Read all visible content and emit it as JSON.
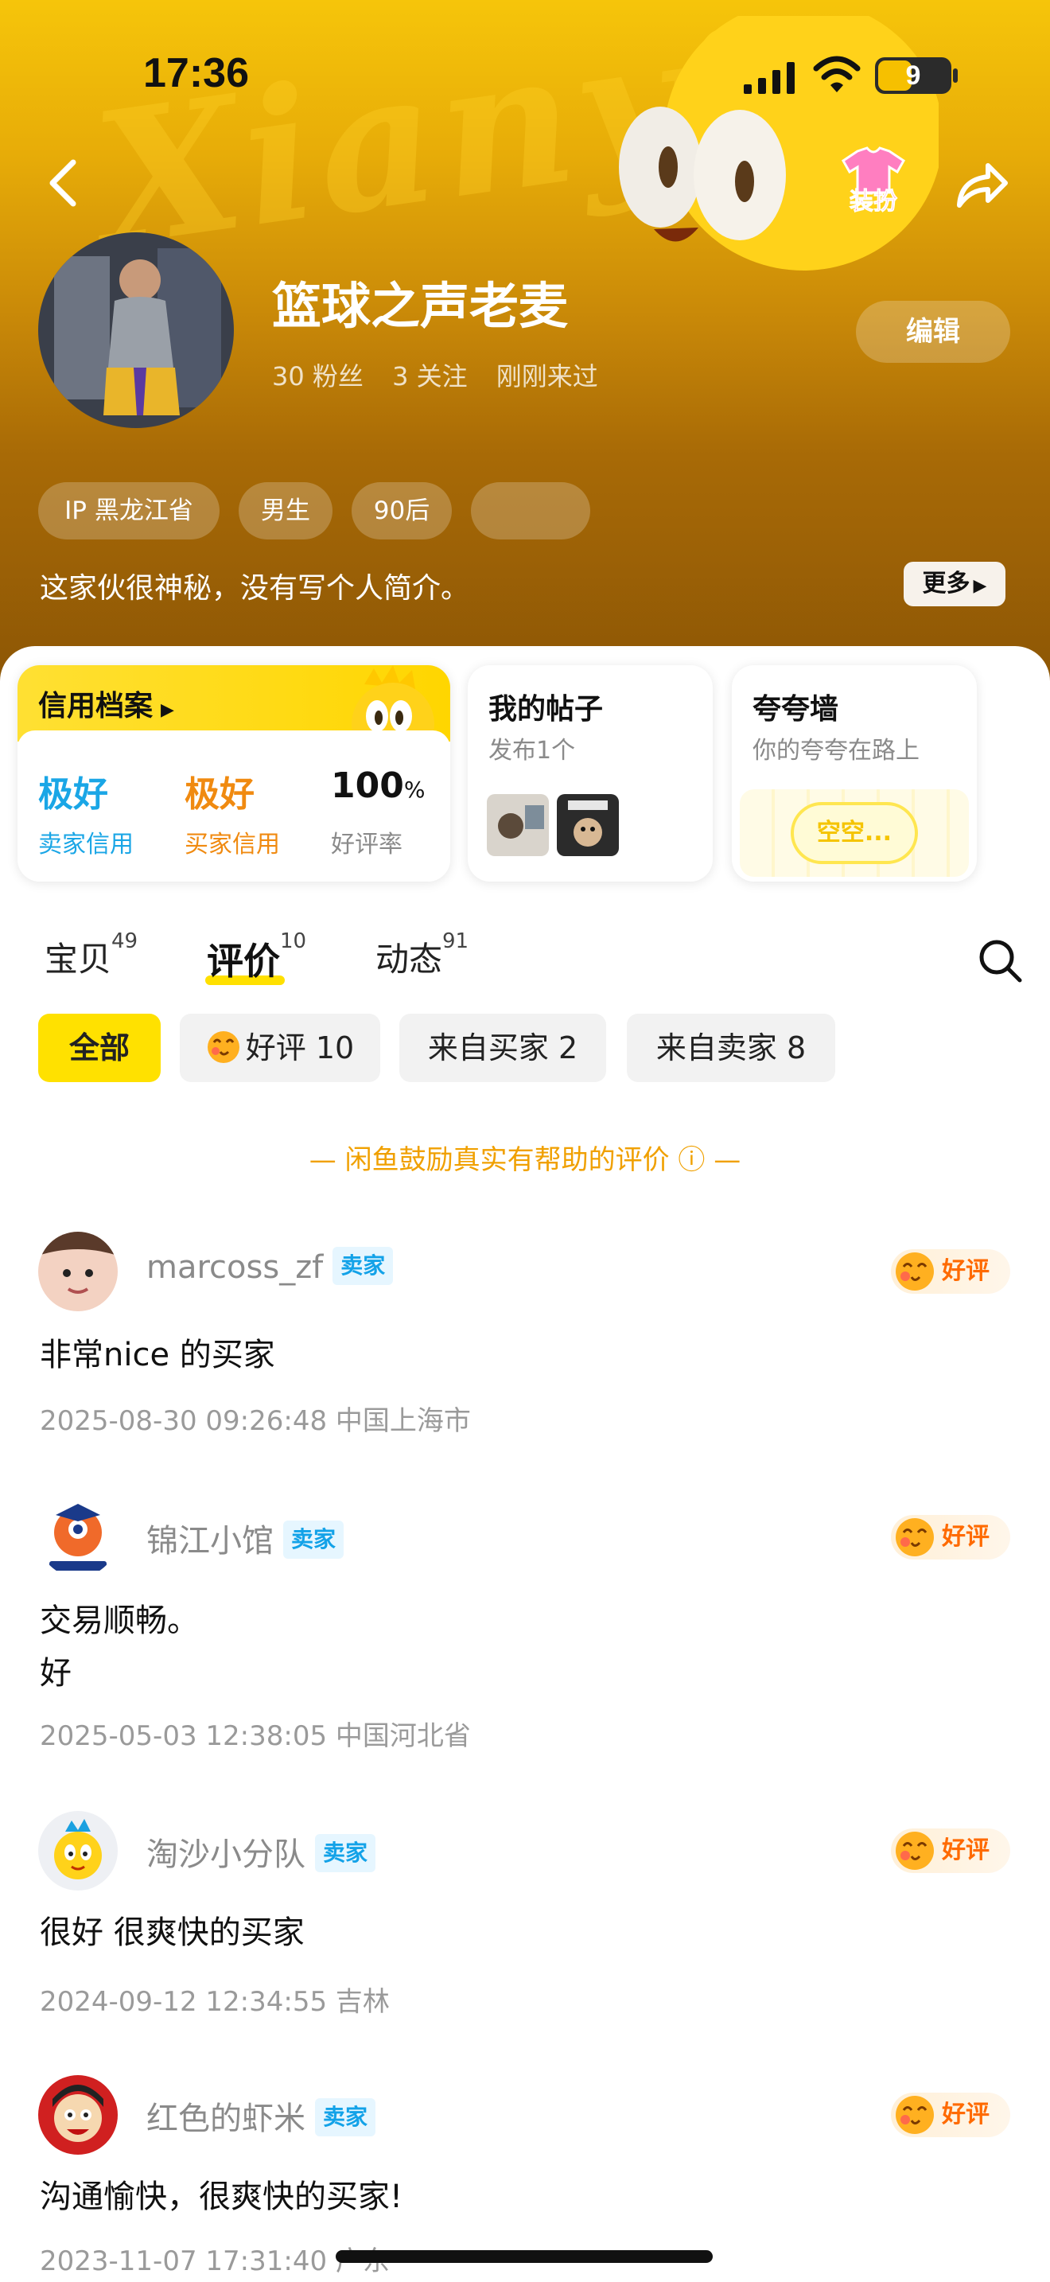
{
  "status_bar": {
    "time": "17:36",
    "battery": "9"
  },
  "header": {
    "outfit_label": "装扮",
    "name": "篮球之声老麦",
    "fans": "30 粉丝",
    "following": "3 关注",
    "last_seen": "刚刚来过",
    "edit_label": "编辑",
    "tags": [
      "IP 黑龙江省",
      "男生",
      "90后",
      ""
    ],
    "bio": "这家伙很神秘，没有写个人简介。",
    "more_label": "更多"
  },
  "cards": {
    "credit": {
      "title": "信用档案",
      "seller_value": "极好",
      "seller_label": "卖家信用",
      "buyer_value": "极好",
      "buyer_label": "买家信用",
      "rate_value": "100",
      "rate_unit": "%",
      "rate_label": "好评率"
    },
    "posts": {
      "title": "我的帖子",
      "subtitle": "发布1个"
    },
    "praise": {
      "title": "夸夸墙",
      "subtitle": "你的夸夸在路上",
      "empty": "空空..."
    }
  },
  "tabs": [
    {
      "label": "宝贝",
      "count": "49"
    },
    {
      "label": "评价",
      "count": "10"
    },
    {
      "label": "动态",
      "count": "91"
    }
  ],
  "filters": [
    {
      "label": "全部"
    },
    {
      "label": "好评 10"
    },
    {
      "label": "来自买家 2"
    },
    {
      "label": "来自卖家 8"
    }
  ],
  "encourage_text": "— 闲鱼鼓励真实有帮助的评价 ⓘ —",
  "reviews": [
    {
      "name": "marcoss_zf",
      "role": "卖家",
      "rating": "好评",
      "text": "非常nice 的买家",
      "meta": "2025-08-30 09:26:48 中国上海市"
    },
    {
      "name": "锦江小馆",
      "role": "卖家",
      "rating": "好评",
      "text": "交易顺畅。",
      "text2": "好",
      "meta": "2025-05-03 12:38:05 中国河北省"
    },
    {
      "name": "淘沙小分队",
      "role": "卖家",
      "rating": "好评",
      "text": "很好 很爽快的买家",
      "meta": "2024-09-12 12:34:55 吉林"
    },
    {
      "name": "红色的虾米",
      "role": "卖家",
      "rating": "好评",
      "text": "沟通愉快，很爽快的买家!",
      "meta": "2023-11-07 17:31:40 广东"
    }
  ],
  "colors": {
    "brand_yellow": "#ffe100",
    "seller_blue": "#1aa6e6",
    "buyer_orange": "#f08a10",
    "good_orange": "#ff6a00"
  }
}
